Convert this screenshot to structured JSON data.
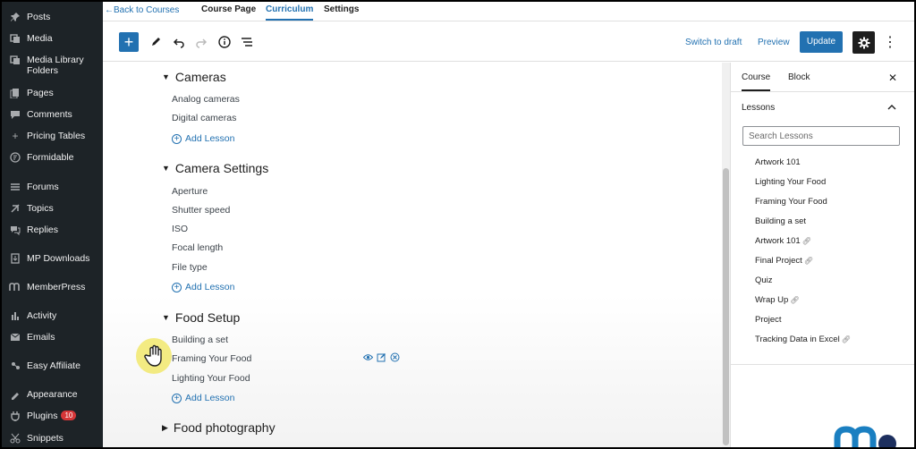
{
  "admin_menu": [
    {
      "label": "Posts",
      "icon": "pin-icon"
    },
    {
      "label": "Media",
      "icon": "media-icon"
    },
    {
      "label": "Media Library Folders",
      "icon": "folders-icon"
    },
    {
      "label": "Pages",
      "icon": "pages-icon"
    },
    {
      "label": "Comments",
      "icon": "comments-icon"
    },
    {
      "label": "Pricing Tables",
      "icon": "plus-icon"
    },
    {
      "label": "Formidable",
      "icon": "formidable-icon"
    },
    {
      "label": "Forums",
      "icon": "forums-icon"
    },
    {
      "label": "Topics",
      "icon": "topics-icon"
    },
    {
      "label": "Replies",
      "icon": "replies-icon"
    },
    {
      "label": "MP Downloads",
      "icon": "downloads-icon"
    },
    {
      "label": "MemberPress",
      "icon": "memberpress-icon"
    },
    {
      "label": "Activity",
      "icon": "activity-icon"
    },
    {
      "label": "Emails",
      "icon": "emails-icon"
    },
    {
      "label": "Easy Affiliate",
      "icon": "affiliate-icon"
    },
    {
      "label": "Appearance",
      "icon": "appearance-icon"
    },
    {
      "label": "Plugins",
      "icon": "plugins-icon",
      "badge": "10"
    },
    {
      "label": "Snippets",
      "icon": "snippets-icon"
    }
  ],
  "nav": {
    "back": "←Back to Courses",
    "tabs": [
      "Course Page",
      "Curriculum",
      "Settings"
    ],
    "active_tab": "Curriculum"
  },
  "toolbar": {
    "switch_draft": "Switch to draft",
    "preview": "Preview",
    "update": "Update"
  },
  "curriculum": {
    "add_lesson": "Add Lesson",
    "sections": [
      {
        "title": "Cameras",
        "lessons": [
          "Analog cameras",
          "Digital cameras"
        ]
      },
      {
        "title": "Camera Settings",
        "lessons": [
          "Aperture",
          "Shutter speed",
          "ISO",
          "Focal length",
          "File type"
        ]
      },
      {
        "title": "Food Setup",
        "lessons": [
          "Building a set",
          "Framing Your Food",
          "Lighting Your Food"
        ]
      },
      {
        "title": "Food photography",
        "lessons": []
      }
    ]
  },
  "sidebar": {
    "tabs": [
      "Course",
      "Block"
    ],
    "active_tab": "Course",
    "panel_title": "Lessons",
    "search_placeholder": "Search Lessons",
    "lessons": [
      {
        "title": "Artwork 101",
        "linked": false
      },
      {
        "title": "Lighting Your Food",
        "linked": false
      },
      {
        "title": "Framing Your Food",
        "linked": false
      },
      {
        "title": "Building a set",
        "linked": false
      },
      {
        "title": "Artwork 101",
        "linked": true
      },
      {
        "title": "Final Project",
        "linked": true
      },
      {
        "title": "Quiz",
        "linked": false
      },
      {
        "title": "Wrap Up",
        "linked": true
      },
      {
        "title": "Project",
        "linked": false
      },
      {
        "title": "Tracking Data in Excel",
        "linked": true
      }
    ]
  },
  "colors": {
    "accent": "#2271b1",
    "admin_bg": "#1d2327",
    "badge": "#d63638"
  }
}
